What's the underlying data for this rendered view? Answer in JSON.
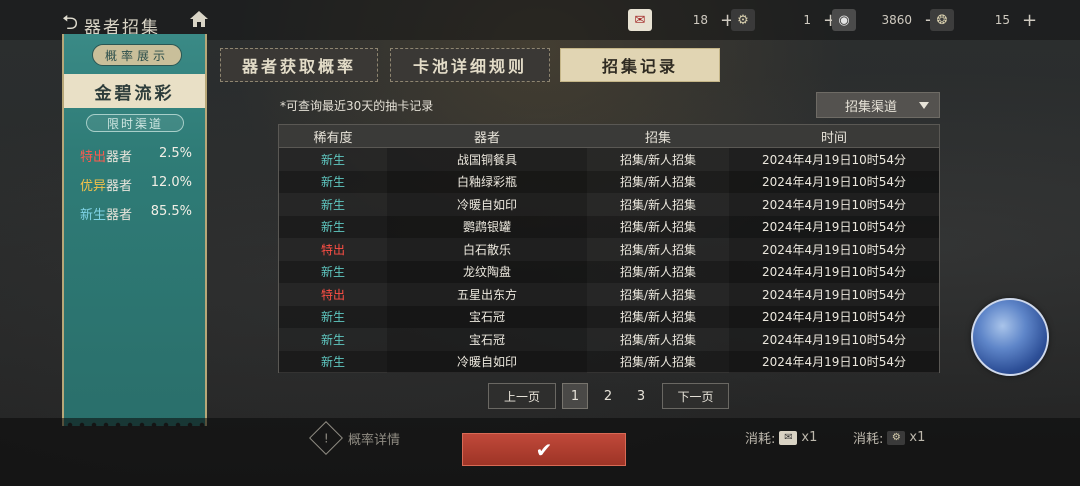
{
  "header": {
    "title": "器者招集",
    "resources": [
      {
        "icon": "ticket-icon",
        "value": "18"
      },
      {
        "icon": "token-icon",
        "value": "1"
      },
      {
        "icon": "coin-icon",
        "value": "3860"
      },
      {
        "icon": "gem-icon",
        "value": "15"
      }
    ]
  },
  "left_panel": {
    "tag": "概率展示",
    "banner_title": "金碧流彩",
    "channel": "限时渠道",
    "rates": [
      {
        "rarity": "特出",
        "suffix": "器者",
        "pct": "2.5%",
        "color": "#ff5a4e"
      },
      {
        "rarity": "优异",
        "suffix": "器者",
        "pct": "12.0%",
        "color": "#f2c14a"
      },
      {
        "rarity": "新生",
        "suffix": "器者",
        "pct": "85.5%",
        "color": "#7fd3e6"
      }
    ]
  },
  "tabs": [
    {
      "label": "器者获取概率",
      "active": false
    },
    {
      "label": "卡池详细规则",
      "active": false
    },
    {
      "label": "招集记录",
      "active": true
    }
  ],
  "note": "*可查询最近30天的抽卡记录",
  "filter": {
    "label": "招集渠道"
  },
  "table": {
    "headers": [
      "稀有度",
      "器者",
      "招集",
      "时间"
    ],
    "rows": [
      {
        "rarity": "新生",
        "name": "战国铜餐具",
        "channel": "招集/新人招集",
        "time": "2024年4月19日10时54分"
      },
      {
        "rarity": "新生",
        "name": "白釉绿彩瓶",
        "channel": "招集/新人招集",
        "time": "2024年4月19日10时54分"
      },
      {
        "rarity": "新生",
        "name": "冷暖自如印",
        "channel": "招集/新人招集",
        "time": "2024年4月19日10时54分"
      },
      {
        "rarity": "新生",
        "name": "鹦鹉银罐",
        "channel": "招集/新人招集",
        "time": "2024年4月19日10时54分"
      },
      {
        "rarity": "特出",
        "name": "白石散乐",
        "channel": "招集/新人招集",
        "time": "2024年4月19日10时54分"
      },
      {
        "rarity": "新生",
        "name": "龙纹陶盘",
        "channel": "招集/新人招集",
        "time": "2024年4月19日10时54分"
      },
      {
        "rarity": "特出",
        "name": "五星出东方",
        "channel": "招集/新人招集",
        "time": "2024年4月19日10时54分"
      },
      {
        "rarity": "新生",
        "name": "宝石冠",
        "channel": "招集/新人招集",
        "time": "2024年4月19日10时54分"
      },
      {
        "rarity": "新生",
        "name": "宝石冠",
        "channel": "招集/新人招集",
        "time": "2024年4月19日10时54分"
      },
      {
        "rarity": "新生",
        "name": "冷暖自如印",
        "channel": "招集/新人招集",
        "time": "2024年4月19日10时54分"
      }
    ]
  },
  "rarity_colors": {
    "新生": "#5fc7c0",
    "特出": "#ff4f45"
  },
  "pagination": {
    "prev": "上一页",
    "pages": [
      "1",
      "2",
      "3"
    ],
    "current": "1",
    "next": "下一页"
  },
  "bottom": {
    "rate_detail": "概率详情",
    "confirm_icon": "check-icon",
    "cost1_label": "消耗:",
    "cost1_value": "x1",
    "cost2_label": "消耗:",
    "cost2_value": "x1"
  }
}
